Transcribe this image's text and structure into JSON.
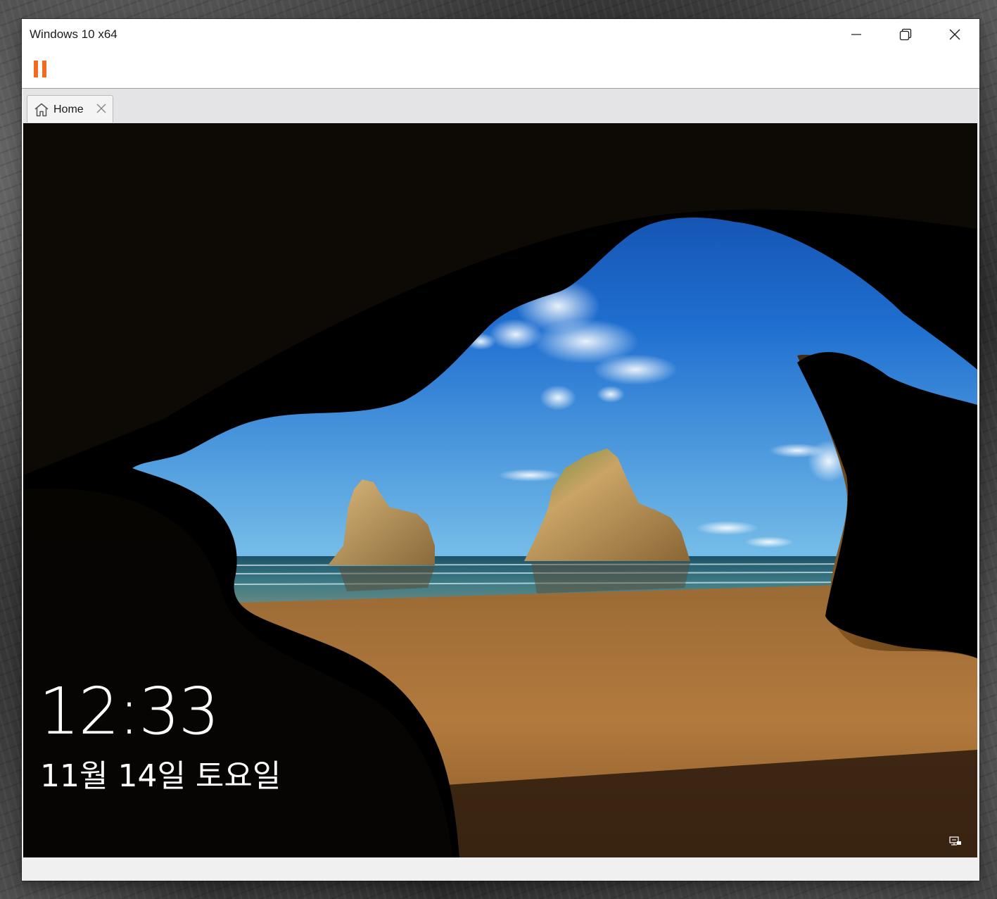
{
  "window": {
    "title": "Windows 10 x64",
    "minimize_icon": "minimize-icon",
    "restore_icon": "restore-icon",
    "close_icon": "close-icon"
  },
  "toolbar": {
    "pause_icon": "pause-icon",
    "pause_color": "#f26b21"
  },
  "tabs": [
    {
      "label": "Home",
      "icon": "home-icon",
      "close_icon": "close-icon"
    }
  ],
  "lockscreen": {
    "time": "12:33",
    "date": "11월 14일 토요일",
    "network_icon": "network-icon"
  }
}
